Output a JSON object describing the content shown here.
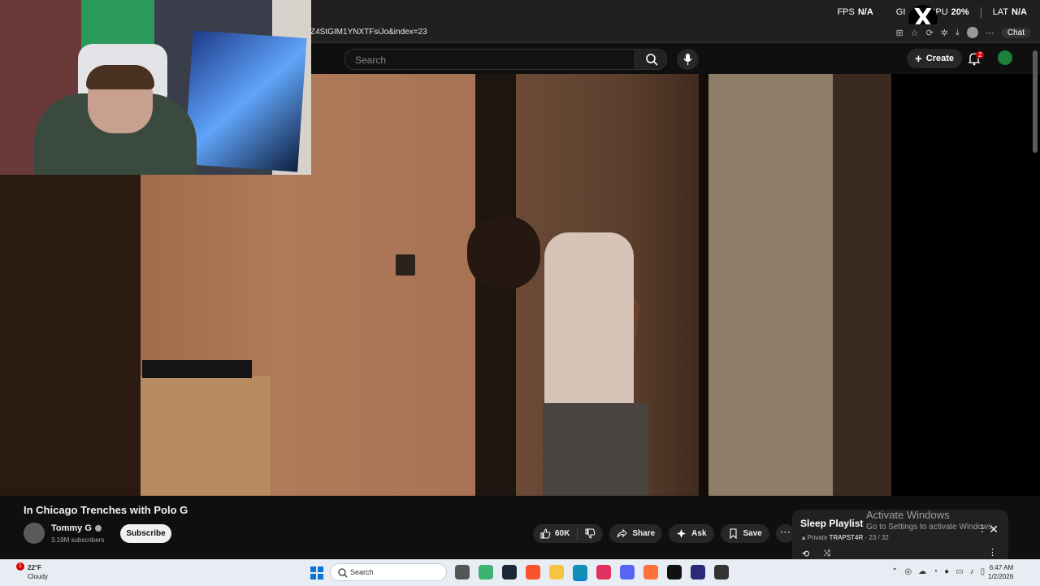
{
  "overlay": {
    "fps_label": "FPS",
    "fps_value": "N/A",
    "gpu_label": "GI",
    "cpu_label": "CPU",
    "cpu_value": "20%",
    "lat_label": "LAT",
    "lat_value": "N/A",
    "x_label": "X"
  },
  "browser": {
    "url": "Z4StGIM1YNXTFsiJo&index=23",
    "chat_label": "Chat"
  },
  "youtube": {
    "search_placeholder": "Search",
    "create_label": "Create",
    "notification_count": "2"
  },
  "video": {
    "title": "In Chicago Trenches with Polo G",
    "channel_name": "Tommy G",
    "subscribers": "3.19M subscribers",
    "subscribe_label": "Subscribe",
    "likes": "60K",
    "share_label": "Share",
    "ask_label": "Ask",
    "save_label": "Save"
  },
  "playlist": {
    "title": "Sleep Playlist",
    "privacy": "Private",
    "owner": "TRAPST4R",
    "position": "- 23 / 32"
  },
  "watermark": {
    "line1": "Activate Windows",
    "line2": "Go to Settings to activate Windows."
  },
  "taskbar": {
    "weather_badge": "1",
    "temperature": "22°F",
    "condition": "Cloudy",
    "search_label": "Search",
    "time": "6:47 AM",
    "date": "1/2/2026"
  },
  "colors": {
    "youtube_bg": "#0f0f0f",
    "notification_red": "#cc0000",
    "taskbar_bg": "#e8ecf3",
    "windows_blue": "#0a74da"
  }
}
